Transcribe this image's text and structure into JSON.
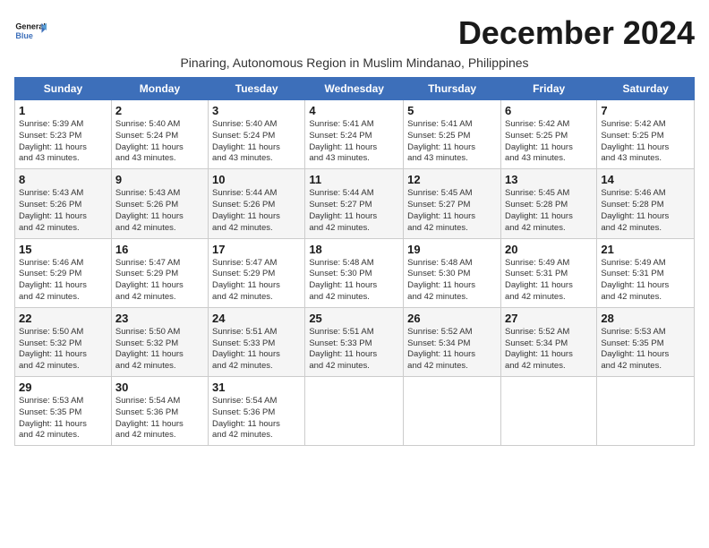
{
  "logo": {
    "line1": "General",
    "line2": "Blue"
  },
  "month_title": "December 2024",
  "subtitle": "Pinaring, Autonomous Region in Muslim Mindanao, Philippines",
  "weekdays": [
    "Sunday",
    "Monday",
    "Tuesday",
    "Wednesday",
    "Thursday",
    "Friday",
    "Saturday"
  ],
  "weeks": [
    [
      {
        "day": "1",
        "info": "Sunrise: 5:39 AM\nSunset: 5:23 PM\nDaylight: 11 hours\nand 43 minutes."
      },
      {
        "day": "2",
        "info": "Sunrise: 5:40 AM\nSunset: 5:24 PM\nDaylight: 11 hours\nand 43 minutes."
      },
      {
        "day": "3",
        "info": "Sunrise: 5:40 AM\nSunset: 5:24 PM\nDaylight: 11 hours\nand 43 minutes."
      },
      {
        "day": "4",
        "info": "Sunrise: 5:41 AM\nSunset: 5:24 PM\nDaylight: 11 hours\nand 43 minutes."
      },
      {
        "day": "5",
        "info": "Sunrise: 5:41 AM\nSunset: 5:25 PM\nDaylight: 11 hours\nand 43 minutes."
      },
      {
        "day": "6",
        "info": "Sunrise: 5:42 AM\nSunset: 5:25 PM\nDaylight: 11 hours\nand 43 minutes."
      },
      {
        "day": "7",
        "info": "Sunrise: 5:42 AM\nSunset: 5:25 PM\nDaylight: 11 hours\nand 43 minutes."
      }
    ],
    [
      {
        "day": "8",
        "info": "Sunrise: 5:43 AM\nSunset: 5:26 PM\nDaylight: 11 hours\nand 42 minutes."
      },
      {
        "day": "9",
        "info": "Sunrise: 5:43 AM\nSunset: 5:26 PM\nDaylight: 11 hours\nand 42 minutes."
      },
      {
        "day": "10",
        "info": "Sunrise: 5:44 AM\nSunset: 5:26 PM\nDaylight: 11 hours\nand 42 minutes."
      },
      {
        "day": "11",
        "info": "Sunrise: 5:44 AM\nSunset: 5:27 PM\nDaylight: 11 hours\nand 42 minutes."
      },
      {
        "day": "12",
        "info": "Sunrise: 5:45 AM\nSunset: 5:27 PM\nDaylight: 11 hours\nand 42 minutes."
      },
      {
        "day": "13",
        "info": "Sunrise: 5:45 AM\nSunset: 5:28 PM\nDaylight: 11 hours\nand 42 minutes."
      },
      {
        "day": "14",
        "info": "Sunrise: 5:46 AM\nSunset: 5:28 PM\nDaylight: 11 hours\nand 42 minutes."
      }
    ],
    [
      {
        "day": "15",
        "info": "Sunrise: 5:46 AM\nSunset: 5:29 PM\nDaylight: 11 hours\nand 42 minutes."
      },
      {
        "day": "16",
        "info": "Sunrise: 5:47 AM\nSunset: 5:29 PM\nDaylight: 11 hours\nand 42 minutes."
      },
      {
        "day": "17",
        "info": "Sunrise: 5:47 AM\nSunset: 5:29 PM\nDaylight: 11 hours\nand 42 minutes."
      },
      {
        "day": "18",
        "info": "Sunrise: 5:48 AM\nSunset: 5:30 PM\nDaylight: 11 hours\nand 42 minutes."
      },
      {
        "day": "19",
        "info": "Sunrise: 5:48 AM\nSunset: 5:30 PM\nDaylight: 11 hours\nand 42 minutes."
      },
      {
        "day": "20",
        "info": "Sunrise: 5:49 AM\nSunset: 5:31 PM\nDaylight: 11 hours\nand 42 minutes."
      },
      {
        "day": "21",
        "info": "Sunrise: 5:49 AM\nSunset: 5:31 PM\nDaylight: 11 hours\nand 42 minutes."
      }
    ],
    [
      {
        "day": "22",
        "info": "Sunrise: 5:50 AM\nSunset: 5:32 PM\nDaylight: 11 hours\nand 42 minutes."
      },
      {
        "day": "23",
        "info": "Sunrise: 5:50 AM\nSunset: 5:32 PM\nDaylight: 11 hours\nand 42 minutes."
      },
      {
        "day": "24",
        "info": "Sunrise: 5:51 AM\nSunset: 5:33 PM\nDaylight: 11 hours\nand 42 minutes."
      },
      {
        "day": "25",
        "info": "Sunrise: 5:51 AM\nSunset: 5:33 PM\nDaylight: 11 hours\nand 42 minutes."
      },
      {
        "day": "26",
        "info": "Sunrise: 5:52 AM\nSunset: 5:34 PM\nDaylight: 11 hours\nand 42 minutes."
      },
      {
        "day": "27",
        "info": "Sunrise: 5:52 AM\nSunset: 5:34 PM\nDaylight: 11 hours\nand 42 minutes."
      },
      {
        "day": "28",
        "info": "Sunrise: 5:53 AM\nSunset: 5:35 PM\nDaylight: 11 hours\nand 42 minutes."
      }
    ],
    [
      {
        "day": "29",
        "info": "Sunrise: 5:53 AM\nSunset: 5:35 PM\nDaylight: 11 hours\nand 42 minutes."
      },
      {
        "day": "30",
        "info": "Sunrise: 5:54 AM\nSunset: 5:36 PM\nDaylight: 11 hours\nand 42 minutes."
      },
      {
        "day": "31",
        "info": "Sunrise: 5:54 AM\nSunset: 5:36 PM\nDaylight: 11 hours\nand 42 minutes."
      },
      {
        "day": "",
        "info": ""
      },
      {
        "day": "",
        "info": ""
      },
      {
        "day": "",
        "info": ""
      },
      {
        "day": "",
        "info": ""
      }
    ]
  ]
}
